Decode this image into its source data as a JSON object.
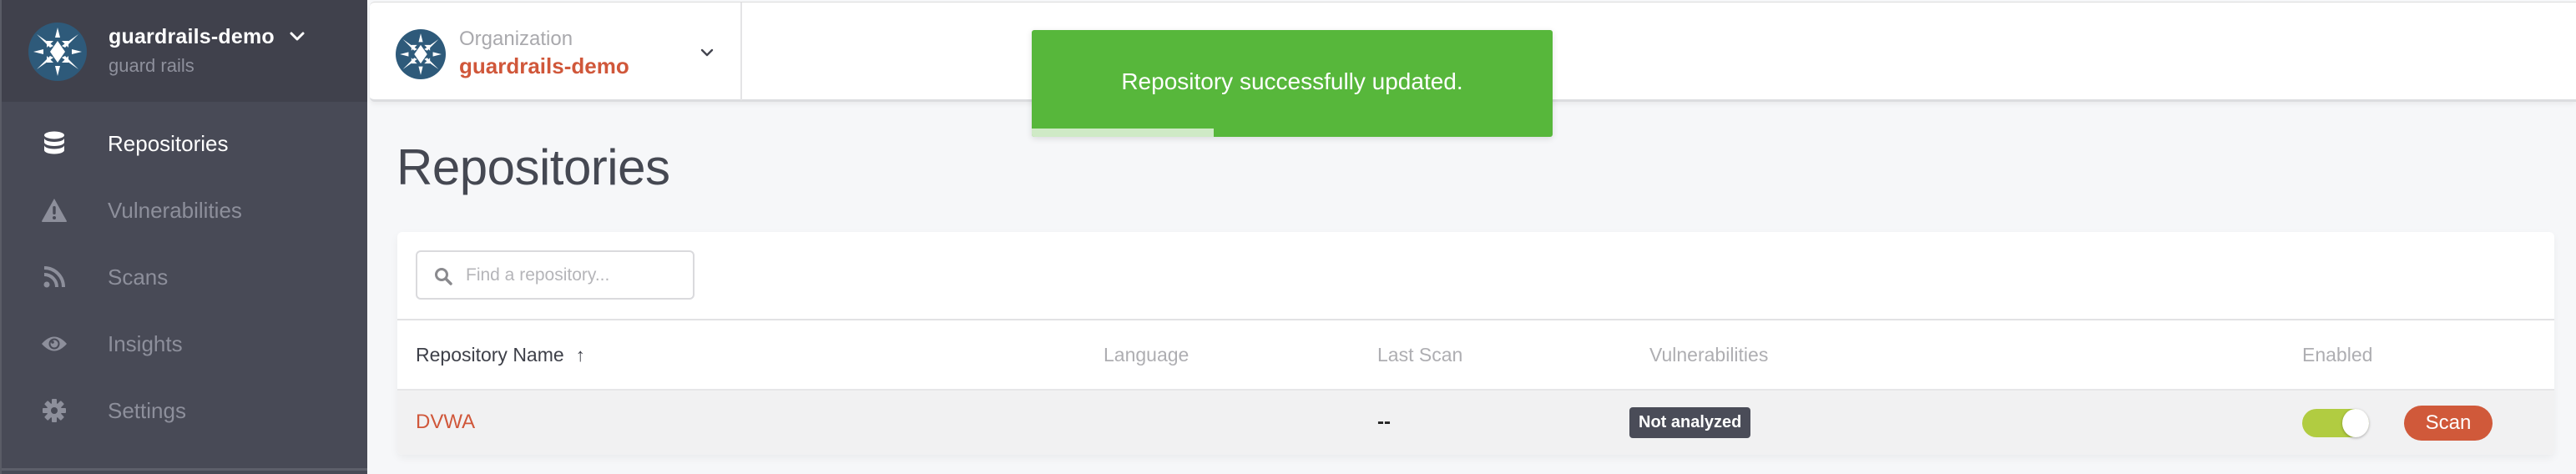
{
  "sidebar": {
    "org_name": "guardrails-demo",
    "org_subtitle": "guard rails",
    "items": [
      {
        "label": "Repositories",
        "icon": "database-icon",
        "active": true
      },
      {
        "label": "Vulnerabilities",
        "icon": "warning-icon",
        "active": false
      },
      {
        "label": "Scans",
        "icon": "rss-icon",
        "active": false
      },
      {
        "label": "Insights",
        "icon": "eye-icon",
        "active": false
      },
      {
        "label": "Settings",
        "icon": "gear-icon",
        "active": false
      }
    ]
  },
  "topbar": {
    "org_label": "Organization",
    "org_value": "guardrails-demo"
  },
  "toast": {
    "message": "Repository successfully updated.",
    "progress_percent": 35,
    "color": "#57b73b"
  },
  "page": {
    "title": "Repositories"
  },
  "search": {
    "placeholder": "Find a repository...",
    "value": ""
  },
  "table": {
    "columns": [
      {
        "label": "Repository Name",
        "sorted": "ascending"
      },
      {
        "label": "Language"
      },
      {
        "label": "Last Scan"
      },
      {
        "label": "Vulnerabilities"
      },
      {
        "label": "Enabled"
      }
    ],
    "rows": [
      {
        "name": "DVWA",
        "language": "",
        "last_scan": "--",
        "vulnerabilities": "Not analyzed",
        "enabled": true,
        "action_label": "Scan"
      }
    ]
  },
  "colors": {
    "accent": "#d0573a",
    "sidebar_bg": "#484a56",
    "toggle_on": "#b1cc41",
    "badge_bg": "#4a4c58"
  }
}
